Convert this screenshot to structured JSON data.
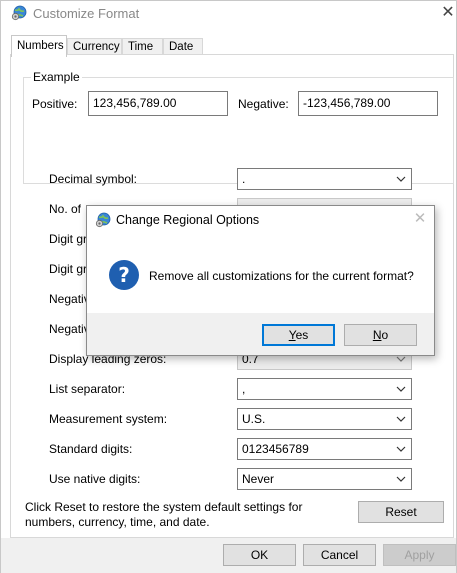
{
  "window": {
    "title": "Customize Format",
    "close_glyph": "✕"
  },
  "tabs": [
    {
      "label": "Numbers",
      "active": true
    },
    {
      "label": "Currency",
      "active": false
    },
    {
      "label": "Time",
      "active": false
    },
    {
      "label": "Date",
      "active": false
    }
  ],
  "example": {
    "label": "Example",
    "positive_label": "Positive:",
    "positive_value": "123,456,789.00",
    "negative_label": "Negative:",
    "negative_value": "-123,456,789.00"
  },
  "settings": [
    {
      "label": "Decimal symbol:",
      "value": ".",
      "disabled": false
    },
    {
      "label": "No. of",
      "value": "",
      "disabled": true
    },
    {
      "label": "Digit gr",
      "value": "",
      "disabled": true
    },
    {
      "label": "Digit gr",
      "value": "",
      "disabled": true
    },
    {
      "label": "Negativ",
      "value": "",
      "disabled": true
    },
    {
      "label": "Negativ",
      "value": "",
      "disabled": true
    },
    {
      "label": "Display leading zeros:",
      "value": "0.7",
      "disabled": true
    },
    {
      "label": "List separator:",
      "value": ",",
      "disabled": false
    },
    {
      "label": "Measurement system:",
      "value": "U.S.",
      "disabled": false
    },
    {
      "label": "Standard digits:",
      "value": "0123456789",
      "disabled": false
    },
    {
      "label": "Use native digits:",
      "value": "Never",
      "disabled": false
    }
  ],
  "hint": "Click Reset to restore the system default settings for numbers, currency, time, and date.",
  "buttons": {
    "reset": "Reset",
    "ok": "OK",
    "cancel": "Cancel",
    "apply": "Apply"
  },
  "dialog": {
    "title": "Change Regional Options",
    "message": "Remove all customizations for the current format?",
    "yes_prefix": "",
    "yes_mnemonic": "Y",
    "yes_rest": "es",
    "no_prefix": "",
    "no_mnemonic": "N",
    "no_rest": "o",
    "close_glyph": "✕"
  },
  "colors": {
    "accent": "#0078d7",
    "question_icon": "#1f5fb0"
  },
  "icons": {
    "app": "globe-gear-icon",
    "question": "question-icon",
    "dropdown": "chevron-down-icon"
  }
}
